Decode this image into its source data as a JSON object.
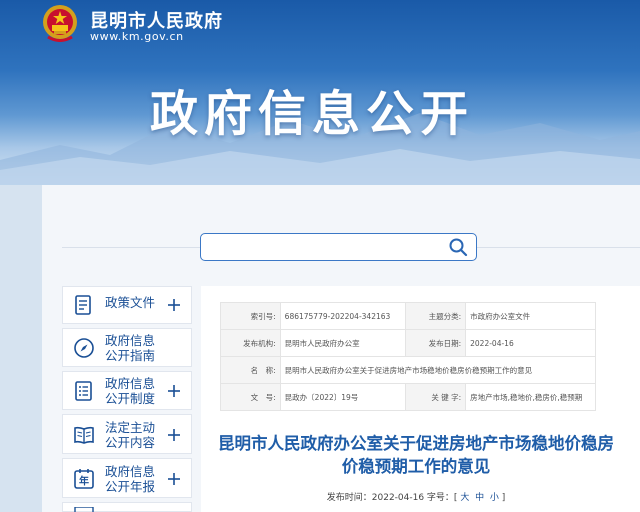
{
  "header": {
    "site_name": "昆明市人民政府",
    "site_url": "www.km.gov.cn",
    "banner_title": "政府信息公开"
  },
  "search": {
    "placeholder": ""
  },
  "sidebar": {
    "items": [
      {
        "label": "政策文件",
        "icon": "document-icon"
      },
      {
        "label": "政府信息\n公开指南",
        "icon": "compass-icon"
      },
      {
        "label": "政府信息\n公开制度",
        "icon": "list-document-icon"
      },
      {
        "label": "法定主动\n公开内容",
        "icon": "open-book-icon"
      },
      {
        "label": "政府信息\n公开年报",
        "icon": "year-calendar-icon",
        "icon_text": "年"
      },
      {
        "label": "",
        "icon": "partial-icon"
      }
    ]
  },
  "document": {
    "meta": {
      "index_label": "索引号:",
      "index_value": "686175779-202204-342163",
      "topic_label": "主题分类:",
      "topic_value": "市政府办公室文件",
      "issuer_label": "发布机构:",
      "issuer_value": "昆明市人民政府办公室",
      "date_label": "发布日期:",
      "date_value": "2022-04-16",
      "name_label": "名　称:",
      "name_value": "昆明市人民政府办公室关于促进房地产市场稳地价稳房价稳预期工作的意见",
      "number_label": "文　号:",
      "number_value": "昆政办〔2022〕19号",
      "keyword_label": "关 键 字:",
      "keyword_value": "房地产市场,稳地价,稳房价,稳预期"
    },
    "title": "昆明市人民政府办公室关于促进房地产市场稳地价稳房价稳预期工作的意见",
    "publish_label": "发布时间：2022-04-16 字号：[",
    "size_large": "大",
    "size_medium": "中",
    "size_small": "小",
    "publish_end": "]"
  },
  "colors": {
    "brand_blue": "#1a4f95",
    "title_blue": "#1f5da8",
    "banner_top": "#1a5aa8"
  }
}
